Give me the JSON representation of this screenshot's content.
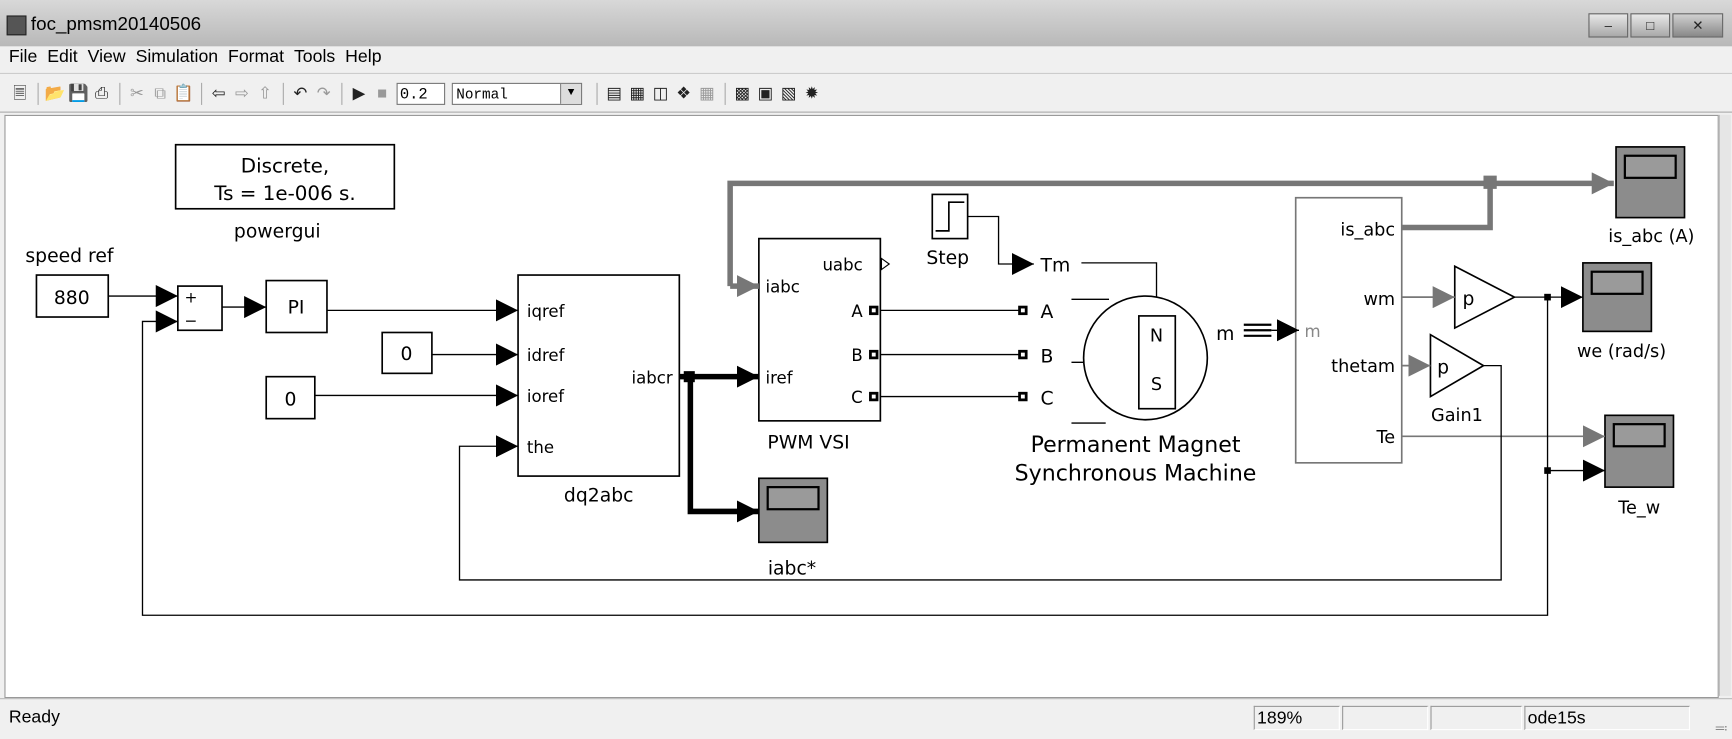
{
  "window": {
    "title": "foc_pmsm20140506",
    "buttons": [
      "minimize",
      "maximize",
      "close"
    ]
  },
  "menu": [
    "File",
    "Edit",
    "View",
    "Simulation",
    "Format",
    "Tools",
    "Help"
  ],
  "toolbar": {
    "left_icons": [
      "new-icon",
      "open-icon",
      "save-icon",
      "print-icon",
      "cut-icon",
      "copy-icon",
      "paste-icon",
      "back-icon",
      "forward-icon",
      "up-icon",
      "undo-icon",
      "redo-icon",
      "play-icon",
      "stop-icon"
    ],
    "stop_time": "0.2",
    "sim_mode": "Normal",
    "right_icons": [
      "update-diagram-icon",
      "build-icon",
      "refresh-icon",
      "model-advisor-icon",
      "debug-icon",
      "library-browser-icon",
      "model-explorer-icon",
      "properties-icon",
      "debugger-icon"
    ]
  },
  "diagram": {
    "powergui": {
      "line1": "Discrete,",
      "line2": "Ts = 1e-006 s.",
      "label": "powergui"
    },
    "speed_ref": {
      "label": "speed ref",
      "value": "880"
    },
    "sum": {
      "plus": "+",
      "minus": "−"
    },
    "pi": "PI",
    "const_id": "0",
    "const_io": "0",
    "dq2abc": {
      "label": "dq2abc",
      "inputs": [
        "iqref",
        "idref",
        "ioref",
        "the"
      ],
      "output": "iabcr"
    },
    "pwm": {
      "label": "PWM VSI",
      "inputs": [
        "iabc",
        "iref"
      ],
      "outputs": [
        "uabc",
        "A",
        "B",
        "C"
      ]
    },
    "scope_iabc": "iabc*",
    "step": "Step",
    "machine": {
      "ports": [
        "Tm",
        "A",
        "B",
        "C"
      ],
      "output": "m",
      "north": "N",
      "south": "S",
      "label1": "Permanent Magnet",
      "label2": "Synchronous Machine"
    },
    "demux": {
      "input": "m",
      "outputs": [
        "is_abc",
        "wm",
        "thetam",
        "Te"
      ]
    },
    "gain": "p",
    "gain1": {
      "value": "p",
      "label": "Gain1"
    },
    "scope_is": "is_abc (A)",
    "scope_we": "we (rad/s)",
    "scope_te": "Te_w"
  },
  "status": {
    "text": "Ready",
    "zoom": "189%",
    "field2": "",
    "field3": "",
    "solver": "ode15s"
  }
}
